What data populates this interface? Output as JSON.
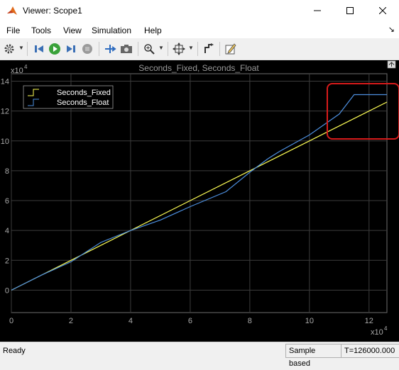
{
  "window": {
    "title": "Viewer: Scope1"
  },
  "menu": [
    "File",
    "Tools",
    "View",
    "Simulation",
    "Help"
  ],
  "toolbar_icons": [
    "gear-icon",
    "step-back-icon",
    "run-icon",
    "step-forward-icon",
    "stop-icon",
    "signal-select-icon",
    "camera-icon",
    "zoom-icon",
    "autoscale-icon",
    "highlight-icon",
    "properties-icon"
  ],
  "plot": {
    "title": "Seconds_Fixed, Seconds_Float",
    "y_exponent": "4",
    "x_exponent": "4"
  },
  "chart_data": {
    "type": "line",
    "title": "Seconds_Fixed, Seconds_Float",
    "x_exponent_label": "x10^4",
    "y_exponent_label": "x10^4",
    "xlim": [
      0,
      12.6
    ],
    "ylim": [
      -1.5,
      14.5
    ],
    "xticks": [
      "0",
      "2",
      "4",
      "6",
      "8",
      "10",
      "12"
    ],
    "yticks": [
      "0",
      "2",
      "4",
      "6",
      "8",
      "10",
      "12",
      "14"
    ],
    "grid": true,
    "legend_position": "top-left",
    "series": [
      {
        "name": "Seconds_Fixed",
        "color": "#ffff55",
        "style": "line",
        "x": [
          0,
          12.6
        ],
        "y": [
          0,
          12.6
        ]
      },
      {
        "name": "Seconds_Float",
        "color": "#4d8fdf",
        "style": "line",
        "x": [
          0,
          1,
          2,
          3,
          4,
          5,
          6,
          7.2,
          8,
          8.6,
          9,
          10,
          11,
          11.5,
          11.9,
          12.6
        ],
        "y": [
          0,
          1,
          1.9,
          3.2,
          4,
          4.7,
          5.6,
          6.6,
          7.9,
          8.8,
          9.3,
          10.4,
          11.8,
          13.1,
          13.1,
          13.1
        ]
      }
    ],
    "annotation": {
      "type": "highlight-box",
      "color": "#d81b1b"
    }
  },
  "status": {
    "left": "Ready",
    "mode": "Sample based",
    "time": "T=126000.000"
  }
}
